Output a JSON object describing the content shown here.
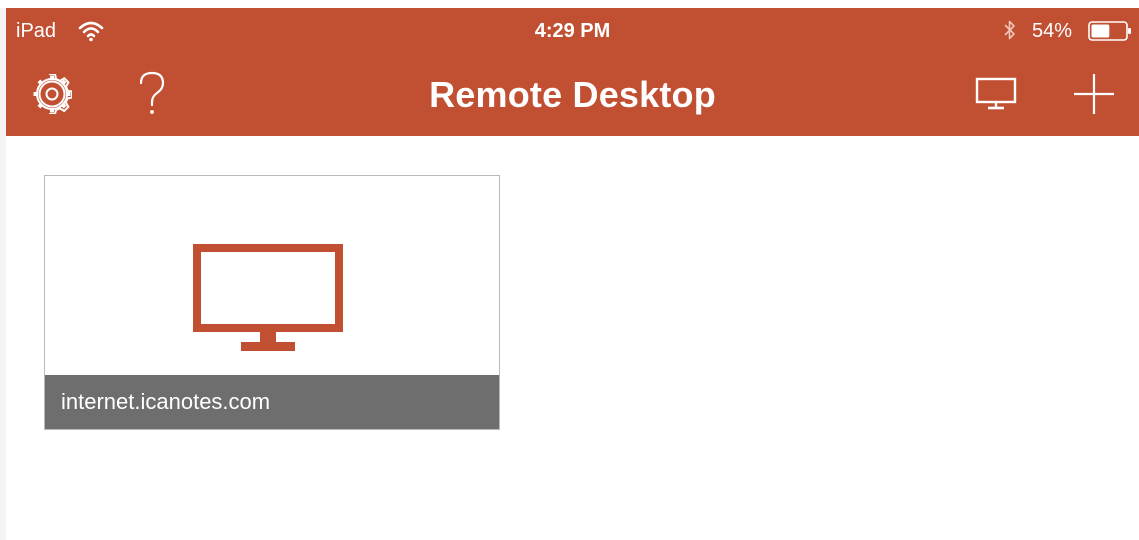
{
  "status_bar": {
    "device": "iPad",
    "time": "4:29 PM",
    "battery_percent": "54%",
    "battery_level": 0.54,
    "icons": [
      "wifi-icon",
      "bluetooth-icon",
      "battery-icon"
    ]
  },
  "nav_bar": {
    "title": "Remote Desktop",
    "icons": {
      "settings": "gear-icon",
      "help": "question-mark-icon",
      "desktops": "monitor-icon",
      "add": "plus-icon"
    }
  },
  "connections": [
    {
      "name": "internet.icanotes.com",
      "icon": "monitor-icon"
    }
  ],
  "colors": {
    "accent": "#c14f32",
    "tile_caption": "#6e6e6e",
    "tile_border": "#b9b9b9",
    "background": "#ffffff"
  }
}
